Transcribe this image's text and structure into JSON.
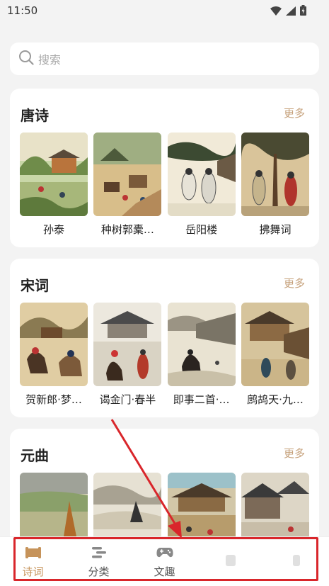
{
  "status": {
    "time": "11:50"
  },
  "search": {
    "placeholder": "搜索"
  },
  "sections": [
    {
      "title": "唐诗",
      "more": "更多",
      "items": [
        "孙泰",
        "种树郭橐…",
        "岳阳楼",
        "拂舞词"
      ]
    },
    {
      "title": "宋词",
      "more": "更多",
      "items": [
        "贺新郎·梦…",
        "谒金门·春半",
        "即事二首·…",
        "鹧鸪天·九…"
      ]
    },
    {
      "title": "元曲",
      "more": "更多",
      "items": [
        "",
        "",
        "",
        ""
      ]
    }
  ],
  "tabs": [
    {
      "label": "诗词",
      "icon": "scroll-icon",
      "active": true
    },
    {
      "label": "分类",
      "icon": "category-icon",
      "active": false
    },
    {
      "label": "文趣",
      "icon": "gamepad-icon",
      "active": false
    },
    {
      "label": "",
      "icon": "faded-icon",
      "active": false
    },
    {
      "label": "",
      "icon": "faded-icon",
      "active": false
    }
  ],
  "colors": {
    "accent": "#c6935a",
    "more": "#c6a17b",
    "annotation": "#d9262b"
  }
}
